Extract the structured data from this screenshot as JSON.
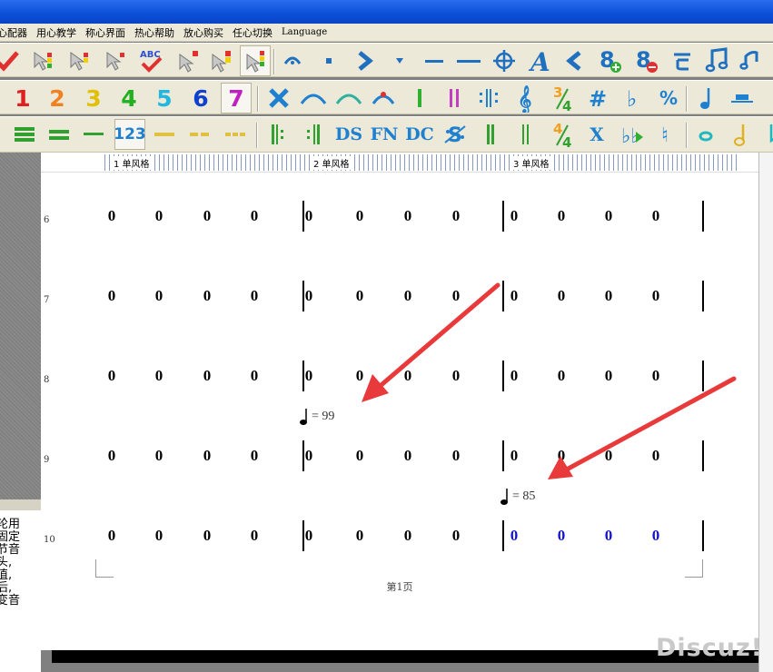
{
  "menu": {
    "items": [
      "心配器",
      "用心教学",
      "称心界面",
      "热心帮助",
      "放心购买",
      "任心切换",
      "Language"
    ]
  },
  "toolbar2": {
    "numbers": [
      "1",
      "2",
      "3",
      "4",
      "5",
      "6",
      "7"
    ],
    "colors": [
      "#e02020",
      "#f08020",
      "#e0c000",
      "#20b020",
      "#20b8e0",
      "#1040d0",
      "#c020c0"
    ]
  },
  "toolbar3": {
    "labels": [
      "123",
      "DS",
      "FN",
      "DC",
      "X"
    ]
  },
  "left_panel": {
    "lines": [
      "轮用",
      "固定",
      "节音",
      "头,",
      "值,",
      "后,",
      "变音"
    ]
  },
  "ruler": {
    "sections": [
      "1 单风格",
      "2 单风格",
      "3 单风格"
    ]
  },
  "score": {
    "row_numbers": [
      "6",
      "7",
      "8",
      "9",
      "10"
    ],
    "note_value": "0",
    "tempos": [
      {
        "text": "= 99"
      },
      {
        "text": "= 85"
      }
    ],
    "footer": "第1页"
  },
  "watermark": "Discuz!",
  "colors": {
    "titlebar": "#0b4fd8",
    "toolbar_bg": "#ece9d8",
    "selected_note": "#1010e0",
    "arrow": "#e83a3a"
  }
}
